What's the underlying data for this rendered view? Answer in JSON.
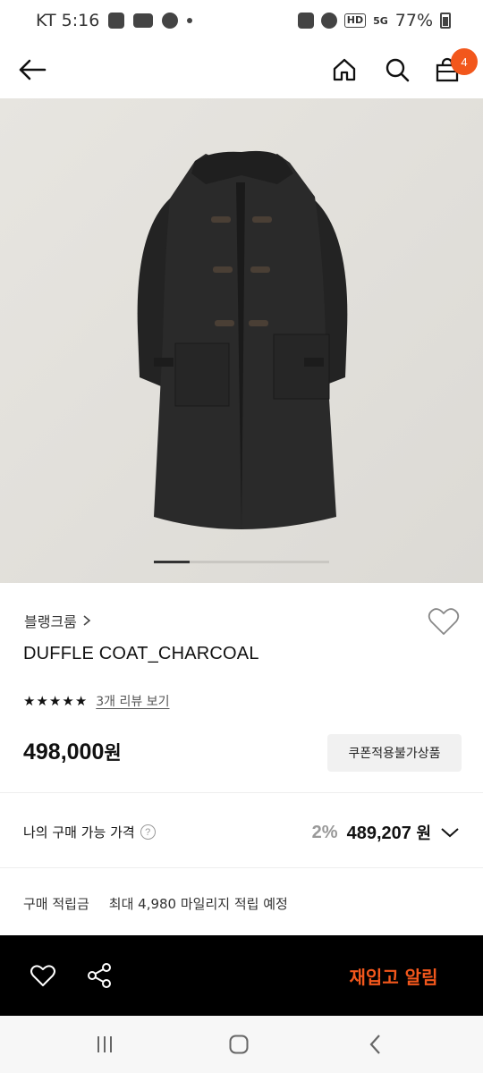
{
  "status_bar": {
    "carrier_time": "KT 5:16",
    "battery": "77%",
    "hd": "HD",
    "network": "5G"
  },
  "nav": {
    "cart_count": "4"
  },
  "gallery": {
    "current_index": 1,
    "total": 5
  },
  "product": {
    "brand": "블랭크룸",
    "name": "DUFFLE COAT_CHARCOAL",
    "rating": 5,
    "review_link": "3개 리뷰 보기",
    "price_value": "498,000",
    "price_unit": "원",
    "coupon_label": "쿠폰적용불가상품"
  },
  "my_price": {
    "label": "나의 구매 가능 가격",
    "help": "?",
    "discount_rate": "2%",
    "price_value": "489,207",
    "price_unit": "원"
  },
  "points": {
    "label": "구매 적립금",
    "value": "최대 4,980 마일리지 적립 예정"
  },
  "actions": {
    "restock_label": "재입고 알림"
  },
  "colors": {
    "accent": "#f2571c",
    "action_bar": "#000000",
    "hero_bg": "#e3e1dc"
  }
}
